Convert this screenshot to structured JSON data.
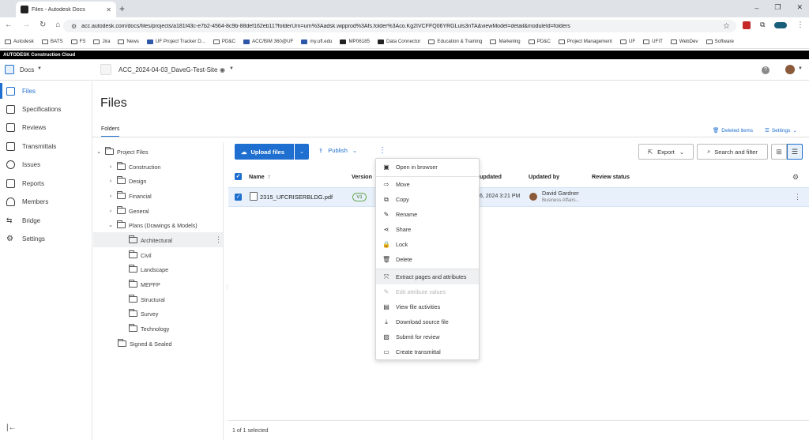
{
  "browser": {
    "tab_title": "Files - Autodesk Docs",
    "url": "acc.autodesk.com/docs/files/projects/a181f43c-e7b2-4564-8c9b-88def162eb11?folderUrn=urn%3Aadsk.wipprod%3Afs.folder%3Aco.Kg2IVCFFQ06YRGLuls3nTA&viewModel=detail&moduleId=folders",
    "bookmarks": [
      "Autodesk",
      "BATS",
      "FS",
      "Jira",
      "News",
      "UF Project Tracker D...",
      "PD&C",
      "ACC/BIM 360@UF",
      "my.ufl.edu",
      "MP06185",
      "Data Connector",
      "Education & Training",
      "Marketing",
      "PD&C",
      "Project Management",
      "UF",
      "UFIT",
      "WebDev",
      "Software"
    ]
  },
  "brand_bar": "AUTODESK Construction Cloud",
  "app": {
    "module": "Docs",
    "project": "ACC_2024-04-03_DaveG-Test-Site"
  },
  "sidebar": {
    "items": [
      {
        "label": "Files",
        "icon": "file-icon",
        "active": true
      },
      {
        "label": "Specifications",
        "icon": "specifications-icon",
        "active": false
      },
      {
        "label": "Reviews",
        "icon": "reviews-icon",
        "active": false
      },
      {
        "label": "Transmittals",
        "icon": "transmittals-icon",
        "active": false
      },
      {
        "label": "Issues",
        "icon": "issues-icon",
        "active": false
      },
      {
        "label": "Reports",
        "icon": "reports-icon",
        "active": false
      },
      {
        "label": "Members",
        "icon": "members-icon",
        "active": false
      },
      {
        "label": "Bridge",
        "icon": "bridge-icon",
        "active": false
      },
      {
        "label": "Settings",
        "icon": "settings-icon",
        "active": false
      }
    ]
  },
  "page": {
    "title": "Files",
    "tab": "Folders",
    "deleted_items": "Deleted items",
    "settings": "Settings"
  },
  "tree": [
    {
      "label": "Project Files",
      "level": 0,
      "expanded": true
    },
    {
      "label": "Construction",
      "level": 1,
      "expanded": false
    },
    {
      "label": "Design",
      "level": 1,
      "expanded": false
    },
    {
      "label": "Financial",
      "level": 1,
      "expanded": false
    },
    {
      "label": "General",
      "level": 1,
      "expanded": false
    },
    {
      "label": "Plans (Drawings & Models)",
      "level": 1,
      "expanded": true
    },
    {
      "label": "Architectural",
      "level": 2,
      "selected": true
    },
    {
      "label": "Civil",
      "level": 2
    },
    {
      "label": "Landscape",
      "level": 2
    },
    {
      "label": "MEPFP",
      "level": 2
    },
    {
      "label": "Structural",
      "level": 2
    },
    {
      "label": "Survey",
      "level": 2
    },
    {
      "label": "Technology",
      "level": 2
    },
    {
      "label": "Signed & Sealed",
      "level": 1
    }
  ],
  "toolbar": {
    "upload": "Upload files",
    "publish": "Publish",
    "export": "Export",
    "search": "Search and filter"
  },
  "table": {
    "headers": {
      "name": "Name",
      "version": "Version",
      "updated": "updated",
      "updated_by": "Updated by",
      "review_status": "Review status"
    },
    "rows": [
      {
        "name": "2315_UFCRISERBLDG.pdf",
        "version": "V1",
        "updated": "6, 2024 3:21 PM",
        "updated_by": "David Gardner",
        "company": "Business Affairs..."
      }
    ],
    "footer": "1 of 1 selected"
  },
  "context_menu": {
    "items": [
      {
        "label": "Open in browser",
        "icon": "open-browser-icon"
      },
      {
        "label": "Move",
        "icon": "move-icon"
      },
      {
        "label": "Copy",
        "icon": "copy-icon"
      },
      {
        "label": "Rename",
        "icon": "rename-icon"
      },
      {
        "label": "Share",
        "icon": "share-icon"
      },
      {
        "label": "Lock",
        "icon": "lock-icon"
      },
      {
        "label": "Delete",
        "icon": "delete-icon"
      },
      {
        "label": "Extract pages and attributes",
        "icon": "extract-icon",
        "highlighted": true
      },
      {
        "label": "Edit attribute values",
        "icon": "edit-attributes-icon",
        "disabled": true
      },
      {
        "label": "View file activities",
        "icon": "activities-icon"
      },
      {
        "label": "Download source file",
        "icon": "download-icon"
      },
      {
        "label": "Submit for review",
        "icon": "review-submit-icon"
      },
      {
        "label": "Create transmittal",
        "icon": "transmittal-create-icon"
      }
    ]
  },
  "colors": {
    "accent": "#1e6fcf",
    "selected_row": "#e8f1fb"
  }
}
